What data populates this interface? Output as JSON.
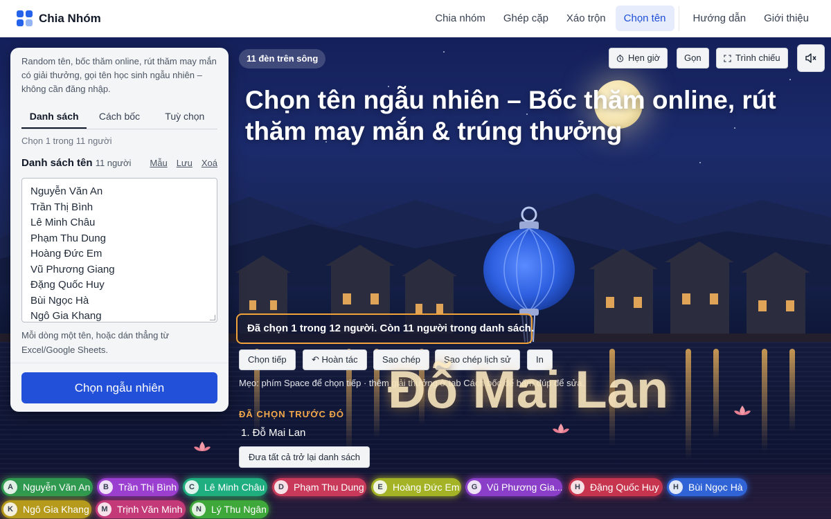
{
  "brand": {
    "name": "Chia Nhóm"
  },
  "nav": [
    "Chia nhóm",
    "Ghép cặp",
    "Xáo trộn",
    "Chọn tên",
    "Hướng dẫn",
    "Giới thiệu"
  ],
  "nav_active": "Chọn tên",
  "panel": {
    "intro": "Random tên, bốc thăm online, rút thăm may mắn có giải thưởng, gọi tên học sinh ngẫu nhiên – không cần đăng nhập.",
    "tabs": [
      "Danh sách",
      "Cách bốc",
      "Tuỳ chọn"
    ],
    "pick_count": "Chọn 1 trong 11 người",
    "list_title": "Danh sách tên",
    "list_count": "11 người",
    "links": {
      "sample": "Mẫu",
      "save": "Lưu",
      "clear": "Xoá"
    },
    "names": [
      "Nguyễn Văn An",
      "Trần Thị Bình",
      "Lê Minh Châu",
      "Phạm Thu Dung",
      "Hoàng Đức Em",
      "Vũ Phương Giang",
      "Đặng Quốc Huy",
      "Bùi Ngọc Hà",
      "Ngô Gia Khang"
    ],
    "hint": "Mỗi dòng một tên, hoặc dán thẳng từ Excel/Google Sheets.",
    "random_button": "Chọn ngẫu nhiên"
  },
  "scene": {
    "chip": "11 đèn trên sông",
    "tools": {
      "timer": "Hẹn giờ",
      "compact": "Gọn",
      "present": "Trình chiếu"
    },
    "headline": "Chọn tên ngẫu nhiên – Bốc thăm online, rút thăm may mắn & trúng thưởng",
    "result": "Đã chọn 1 trong 12 người. Còn 11 người trong danh sách.",
    "actions": [
      "Chọn tiếp",
      "Hoàn tác",
      "Sao chép",
      "Sao chép lịch sử",
      "In"
    ],
    "tip": "Mẹo: phím Space để chọn tiếp · thêm giải thưởng ở tab Cách bốc để bấm đúp để sửa.",
    "winner": "Đỗ Mai Lan",
    "previous_title": "ĐÃ CHỌN TRƯỚC ĐÓ",
    "previous": [
      "1. Đỗ Mai Lan"
    ],
    "return_button": "Đưa tất cả trở lại danh sách"
  },
  "strip": [
    {
      "badge": "A",
      "name": "Nguyễn Văn An",
      "color": "#2f9a4f"
    },
    {
      "badge": "B",
      "name": "Trần Thị Bình",
      "color": "#9b3fd1"
    },
    {
      "badge": "C",
      "name": "Lê Minh Châu",
      "color": "#1fae7f"
    },
    {
      "badge": "D",
      "name": "Phạm Thu Dung",
      "color": "#c93a5a"
    },
    {
      "badge": "E",
      "name": "Hoàng Đức Em",
      "color": "#a3b325"
    },
    {
      "badge": "G",
      "name": "Vũ Phương Gia...",
      "color": "#8b3fc9"
    },
    {
      "badge": "H",
      "name": "Đặng Quốc Huy",
      "color": "#c7344d"
    },
    {
      "badge": "H",
      "name": "Bùi Ngọc Hà",
      "color": "#2f63d6"
    },
    {
      "badge": "K",
      "name": "Ngô Gia Khang",
      "color": "#b59a1c"
    },
    {
      "badge": "M",
      "name": "Trịnh Văn Minh",
      "color": "#c43a78"
    },
    {
      "badge": "N",
      "name": "Lý Thu Ngân",
      "color": "#3ea83a"
    }
  ]
}
